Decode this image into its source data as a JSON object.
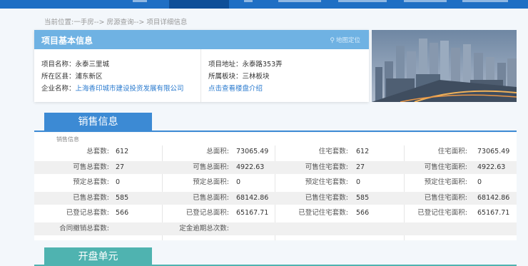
{
  "breadcrumb": "当前位置:一手房--> 房源查询--> 项目详细信息",
  "project_card": {
    "title": "项目基本信息",
    "map_link": "地图定位",
    "project_name": "项目名称：永泰三里城",
    "district": "所在区县：浦东新区",
    "company_label": "企业名称：",
    "company_name": "上海香印城市建设投资发展有限公司",
    "address": "项目地址：永泰路353弄",
    "block": "所属板块：三林板块",
    "intro_link": "点击查看楼盘介绍"
  },
  "sales_section": {
    "tab_label": "销售信息",
    "caption": "销售信息",
    "rows": [
      {
        "c1_label": "总套数:",
        "c1_val": "612",
        "c2_label": "总面积:",
        "c2_val": "73065.49",
        "c3_label": "住宅套数:",
        "c3_val": "612",
        "c4_label": "住宅面积:",
        "c4_val": "73065.49"
      },
      {
        "c1_label": "可售总套数:",
        "c1_val": "27",
        "c2_label": "可售总面积:",
        "c2_val": "4922.63",
        "c3_label": "可售住宅套数:",
        "c3_val": "27",
        "c4_label": "可售住宅面积:",
        "c4_val": "4922.63"
      },
      {
        "c1_label": "预定总套数:",
        "c1_val": "0",
        "c2_label": "预定总面积:",
        "c2_val": "0",
        "c3_label": "预定住宅套数:",
        "c3_val": "0",
        "c4_label": "预定住宅面积:",
        "c4_val": "0"
      },
      {
        "c1_label": "已售总套数:",
        "c1_val": "585",
        "c2_label": "已售总面积:",
        "c2_val": "68142.86",
        "c3_label": "已售住宅套数:",
        "c3_val": "585",
        "c4_label": "已售住宅面积:",
        "c4_val": "68142.86"
      },
      {
        "c1_label": "已登记总套数:",
        "c1_val": "566",
        "c2_label": "已登记总面积:",
        "c2_val": "65167.71",
        "c3_label": "已登记住宅套数:",
        "c3_val": "566",
        "c4_label": "已登记住宅面积:",
        "c4_val": "65167.71"
      },
      {
        "c1_label": "合同撤销总套数:",
        "c1_val": "",
        "c2_label": "定金逾期总次数:",
        "c2_val": "",
        "c3_label": "",
        "c3_val": "",
        "c4_label": "",
        "c4_val": ""
      }
    ]
  },
  "open_section": {
    "tab_label": "开盘单元"
  },
  "colors": {
    "nav_blue": "#1f6fc4",
    "card_header": "#6fb2e3",
    "sales_tab": "#3c8ad4",
    "open_tab": "#4fb3b0",
    "link": "#2b7bcf"
  }
}
